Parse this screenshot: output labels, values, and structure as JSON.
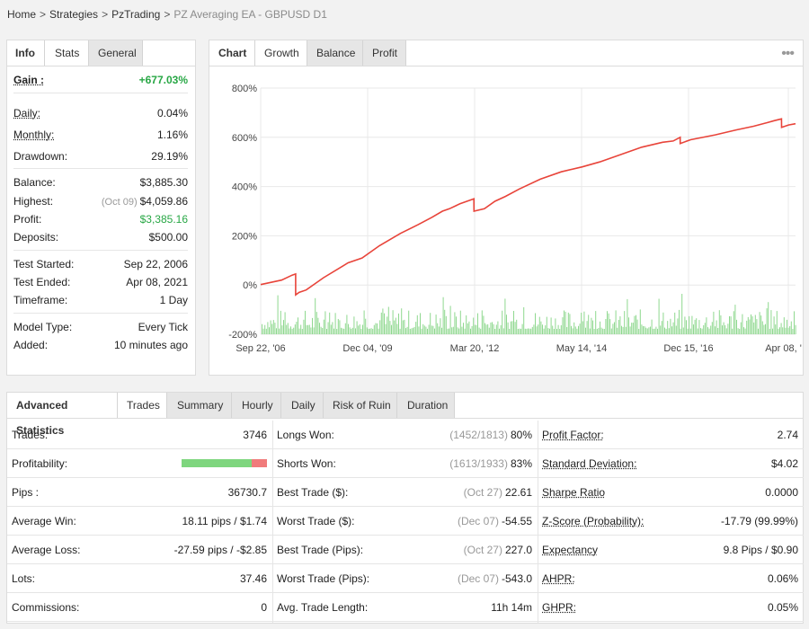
{
  "breadcrumb": {
    "items": [
      "Home",
      "Strategies",
      "PzTrading"
    ],
    "current": "PZ Averaging EA - GBPUSD D1",
    "separator": ">"
  },
  "stats_panel": {
    "tabs": [
      "Info",
      "Stats",
      "General"
    ],
    "gain": {
      "label": "Gain :",
      "value": "+677.03%"
    },
    "rows": [
      {
        "label": "Daily:",
        "value": "0.04%"
      },
      {
        "label": "Monthly:",
        "value": "1.16%"
      },
      {
        "label": "Drawdown:",
        "value": "29.19%"
      },
      {
        "label": "Balance:",
        "value": "$3,885.30"
      },
      {
        "label": "Highest:",
        "note": "(Oct 09)",
        "value": "$4,059.86"
      },
      {
        "label": "Profit:",
        "value": "$3,385.16"
      },
      {
        "label": "Deposits:",
        "value": "$500.00"
      },
      {
        "label": "Test Started:",
        "value": "Sep 22, 2006"
      },
      {
        "label": "Test Ended:",
        "value": "Apr 08, 2021"
      },
      {
        "label": "Timeframe:",
        "value": "1 Day"
      },
      {
        "label": "Model Type:",
        "value": "Every Tick"
      },
      {
        "label": "Added:",
        "value": "10 minutes ago"
      }
    ]
  },
  "chart_panel": {
    "tabs": [
      "Chart",
      "Growth",
      "Balance",
      "Profit"
    ],
    "more_icon": "•••"
  },
  "chart_data": {
    "type": "line",
    "x_tick_labels": [
      "Sep 22, '06",
      "Dec 04, '09",
      "Mar 20, '12",
      "May 14, '14",
      "Dec 15, '16",
      "Apr 08, '…"
    ],
    "y_tick_labels": [
      "800%",
      "600%",
      "400%",
      "200%",
      "0%",
      "-200%"
    ],
    "ylim": [
      -200,
      800
    ],
    "grid": true,
    "line_color": "#e8443a",
    "bar_color": "#8fd88f",
    "series": [
      {
        "values": [
          [
            0,
            2
          ],
          [
            6,
            20
          ],
          [
            9,
            40
          ],
          [
            10,
            45
          ],
          [
            10.01,
            -40
          ],
          [
            11,
            -30
          ],
          [
            13,
            -20
          ],
          [
            18,
            30
          ],
          [
            25,
            90
          ],
          [
            29,
            110
          ],
          [
            34,
            160
          ],
          [
            40,
            210
          ],
          [
            45,
            245
          ],
          [
            49,
            275
          ],
          [
            52,
            300
          ],
          [
            54,
            310
          ],
          [
            57,
            330
          ],
          [
            61,
            350
          ],
          [
            61.01,
            300
          ],
          [
            64,
            310
          ],
          [
            67,
            340
          ],
          [
            70,
            360
          ],
          [
            74,
            390
          ],
          [
            80,
            430
          ],
          [
            86,
            460
          ],
          [
            92,
            480
          ],
          [
            97,
            500
          ],
          [
            103,
            530
          ],
          [
            109,
            560
          ],
          [
            115,
            580
          ],
          [
            118,
            585
          ],
          [
            120,
            600
          ],
          [
            120.01,
            575
          ],
          [
            123,
            590
          ],
          [
            130,
            610
          ],
          [
            136,
            630
          ],
          [
            141,
            645
          ],
          [
            145,
            660
          ],
          [
            147,
            668
          ],
          [
            149,
            675
          ],
          [
            149.01,
            640
          ],
          [
            151,
            650
          ],
          [
            153,
            655
          ]
        ]
      }
    ],
    "x_range": [
      0,
      153
    ]
  },
  "advanced": {
    "tabs": [
      "Advanced Statistics",
      "Trades",
      "Summary",
      "Hourly",
      "Daily",
      "Risk of Ruin",
      "Duration"
    ],
    "col1": [
      {
        "label": "Trades:",
        "value": "3746"
      },
      {
        "label": "Profitability:",
        "bar": {
          "green": 0.82,
          "red": 0.18
        }
      },
      {
        "label": "Pips :",
        "value": "36730.7"
      },
      {
        "label": "Average Win:",
        "value": "18.11 pips / $1.74"
      },
      {
        "label": "Average Loss:",
        "value": "-27.59 pips / -$2.85"
      },
      {
        "label": "Lots:",
        "value": "37.46"
      },
      {
        "label": "Commissions:",
        "value": "0"
      }
    ],
    "col2": [
      {
        "label": "Longs Won:",
        "note": "(1452/1813)",
        "value": "80%"
      },
      {
        "label": "Shorts Won:",
        "note": "(1613/1933)",
        "value": "83%"
      },
      {
        "label": "Best Trade ($):",
        "note": "(Oct 27)",
        "value": "22.61"
      },
      {
        "label": "Worst Trade ($):",
        "note": "(Dec 07)",
        "value": "-54.55"
      },
      {
        "label": "Best Trade (Pips):",
        "note": "(Oct 27)",
        "value": "227.0"
      },
      {
        "label": "Worst Trade (Pips):",
        "note": "(Dec 07)",
        "value": "-543.0"
      },
      {
        "label": "Avg. Trade Length:",
        "value": "11h 14m"
      }
    ],
    "col3": [
      {
        "label": "Profit Factor:",
        "value": "2.74"
      },
      {
        "label": "Standard Deviation:",
        "value": "$4.02"
      },
      {
        "label": "Sharpe Ratio",
        "value": "0.0000"
      },
      {
        "label": "Z-Score (Probability):",
        "value": "-17.79 (99.99%)"
      },
      {
        "label": "Expectancy",
        "value": "9.8 Pips / $0.90"
      },
      {
        "label": "AHPR:",
        "value": "0.06%"
      },
      {
        "label": "GHPR:",
        "value": "0.05%"
      }
    ]
  }
}
